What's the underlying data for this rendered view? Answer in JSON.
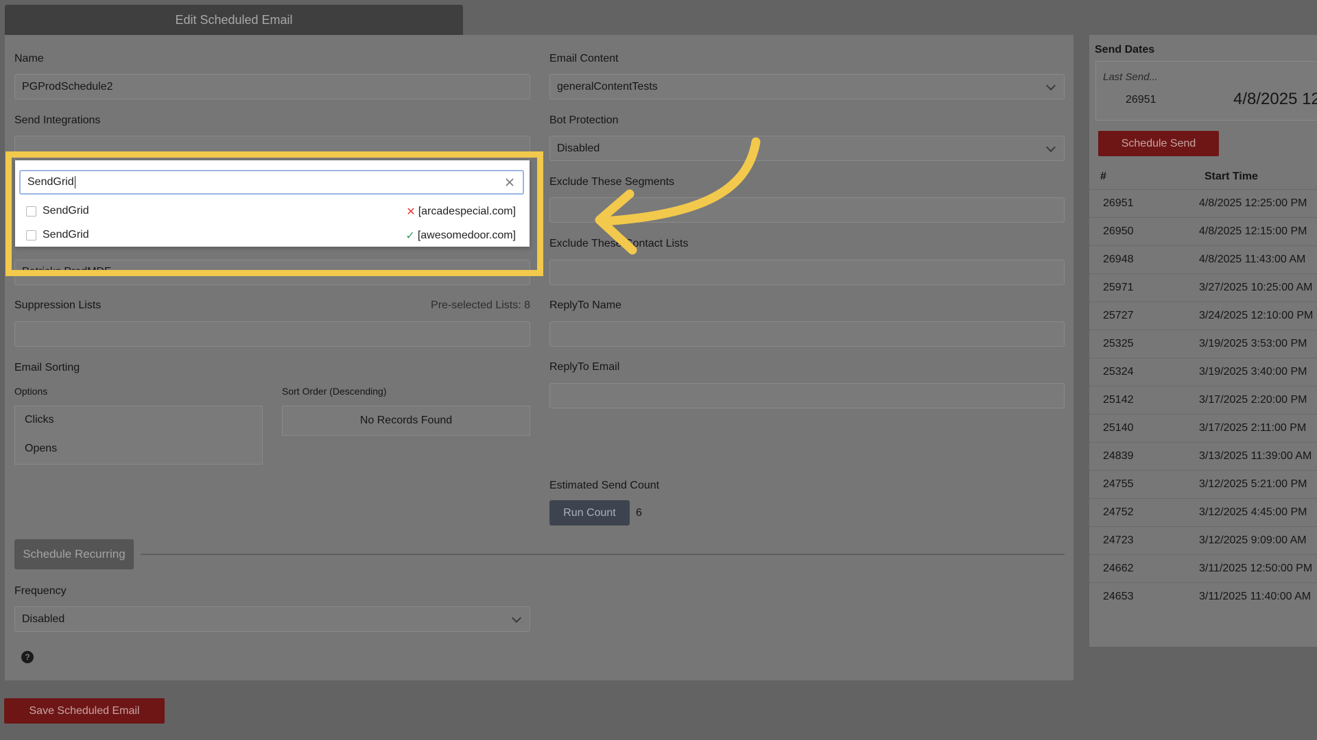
{
  "header": {
    "title": "Edit Scheduled Email"
  },
  "form": {
    "name_label": "Name",
    "name_value": "PGProdSchedule2",
    "send_integrations_label": "Send Integrations",
    "partial_field_text": "Patricks ProdMDF",
    "suppression_label": "Suppression Lists",
    "preselected_text": "Pre-selected Lists: 8",
    "email_sorting_label": "Email Sorting",
    "options_label": "Options",
    "options": [
      "Clicks",
      "Opens"
    ],
    "sort_order_label": "Sort Order (Descending)",
    "no_records": "No Records Found",
    "schedule_recurring_label": "Schedule Recurring",
    "frequency_label": "Frequency",
    "frequency_value": "Disabled",
    "help_glyph": "?",
    "email_content_label": "Email Content",
    "email_content_value": "generalContentTests",
    "bot_protection_label": "Bot Protection",
    "bot_protection_value": "Disabled",
    "exclude_segments_label": "Exclude These Segments",
    "exclude_contacts_label": "Exclude These Contact Lists",
    "reply_to_name_label": "ReplyTo Name",
    "reply_to_email_label": "ReplyTo Email",
    "estimated_label": "Estimated Send Count",
    "run_count_label": "Run Count",
    "count_value": "6",
    "save_label": "Save Scheduled Email"
  },
  "dropdown": {
    "search_value": "SendGrid",
    "options": [
      {
        "name": "SendGrid",
        "domain": "[arcadespecial.com]",
        "status": "x"
      },
      {
        "name": "SendGrid",
        "domain": "[awesomedoor.com]",
        "status": "check"
      }
    ]
  },
  "side": {
    "title": "Send Dates",
    "last_send_label": "Last Send...",
    "last_send_id": "26951",
    "last_send_date": "4/8/2025 12",
    "schedule_send_label": "Schedule Send",
    "col_id": "#",
    "col_start": "Start Time",
    "rows": [
      {
        "id": "26951",
        "start": "4/8/2025 12:25:00 PM"
      },
      {
        "id": "26950",
        "start": "4/8/2025 12:15:00 PM"
      },
      {
        "id": "26948",
        "start": "4/8/2025 11:43:00 AM"
      },
      {
        "id": "25971",
        "start": "3/27/2025 10:25:00 AM"
      },
      {
        "id": "25727",
        "start": "3/24/2025 12:10:00 PM"
      },
      {
        "id": "25325",
        "start": "3/19/2025 3:53:00 PM"
      },
      {
        "id": "25324",
        "start": "3/19/2025 3:40:00 PM"
      },
      {
        "id": "25142",
        "start": "3/17/2025 2:20:00 PM"
      },
      {
        "id": "25140",
        "start": "3/17/2025 2:11:00 PM"
      },
      {
        "id": "24839",
        "start": "3/13/2025 11:39:00 AM"
      },
      {
        "id": "24755",
        "start": "3/12/2025 5:21:00 PM"
      },
      {
        "id": "24752",
        "start": "3/12/2025 4:45:00 PM"
      },
      {
        "id": "24723",
        "start": "3/12/2025 9:09:00 AM"
      },
      {
        "id": "24662",
        "start": "3/11/2025 12:50:00 PM"
      },
      {
        "id": "24653",
        "start": "3/11/2025 11:40:00 AM"
      }
    ]
  },
  "colors": {
    "accent_red": "#6e1616",
    "highlight_yellow": "#f2c94c",
    "success_green": "#2e9d55",
    "error_red": "#e53935"
  }
}
